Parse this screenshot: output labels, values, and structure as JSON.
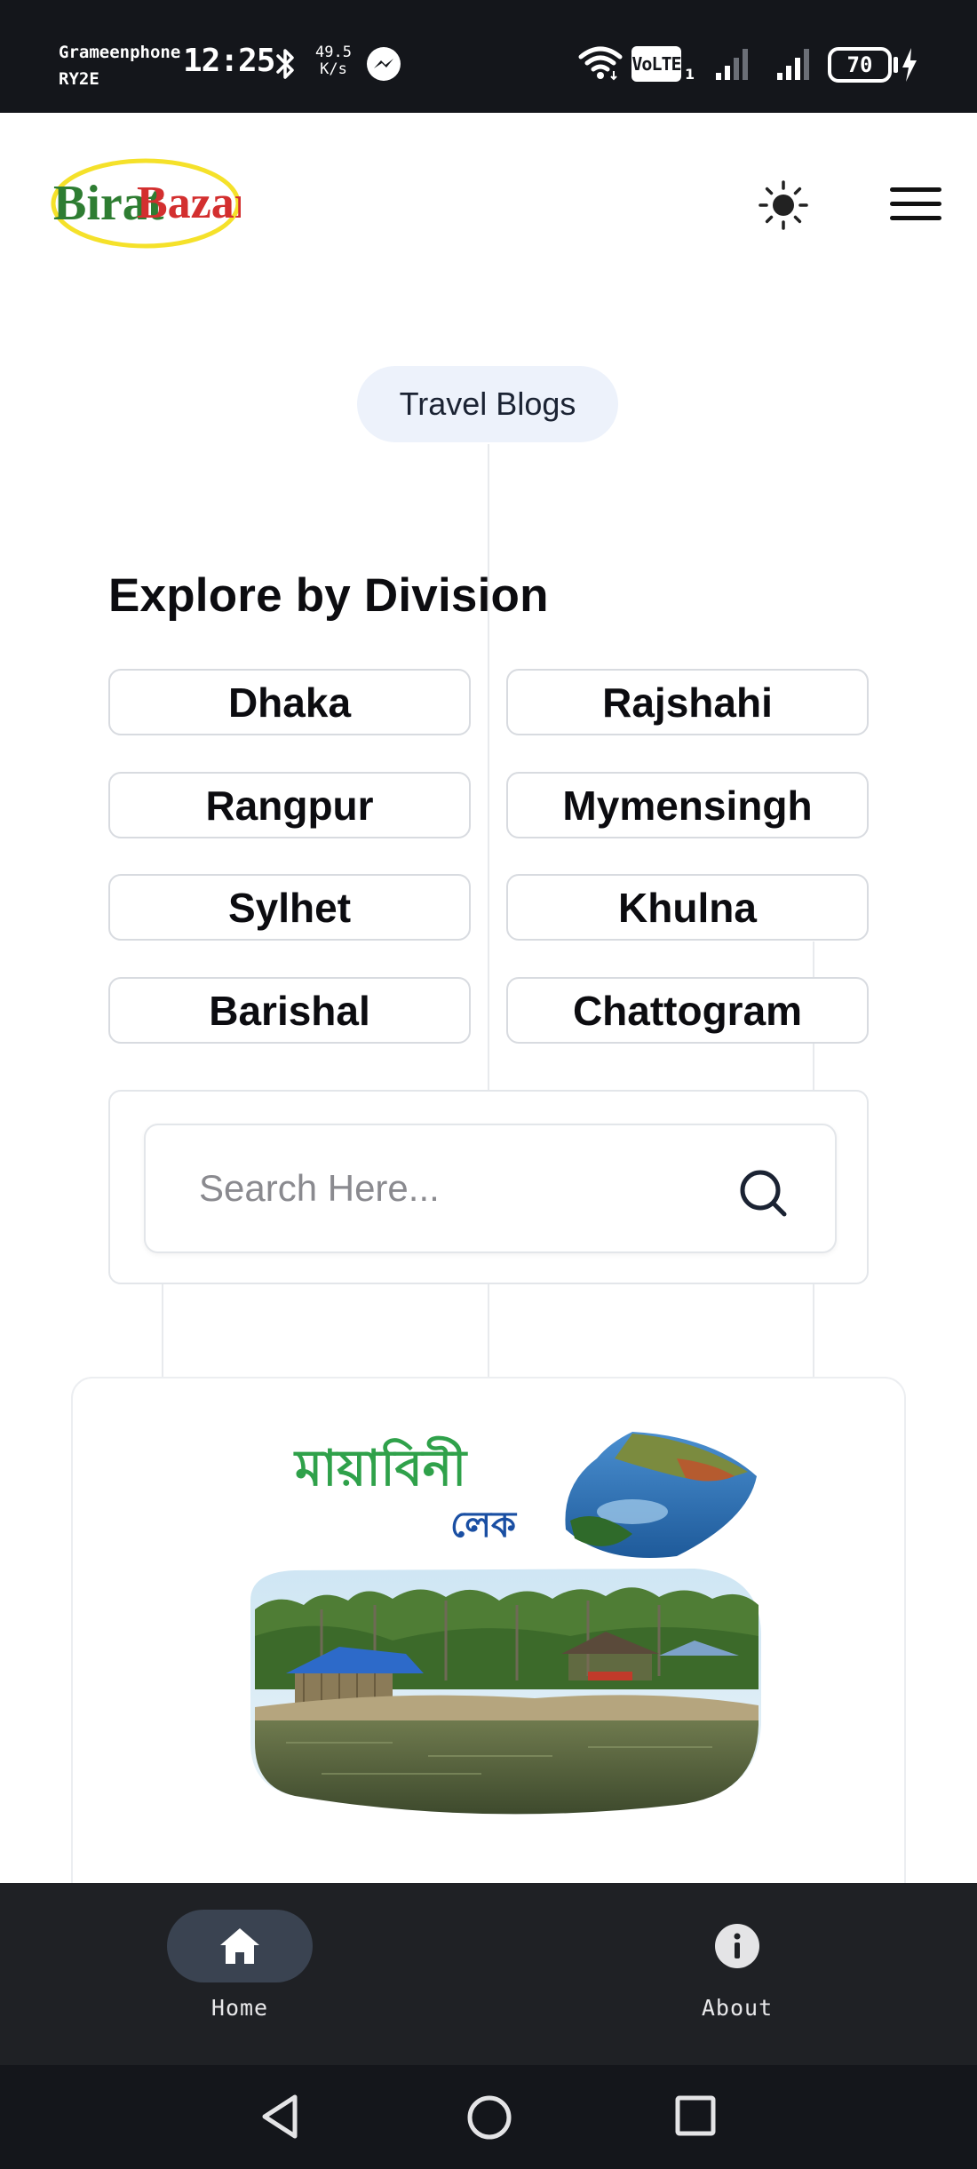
{
  "status_bar": {
    "carrier_line1": "Grameenphone",
    "carrier_line2": "RY2E",
    "time": "12:25",
    "speed_value": "49.5",
    "speed_unit": "K/s",
    "volte": "VoLTE",
    "volte_sub": "1",
    "battery": "70"
  },
  "header": {
    "logo_text_part1": "Birat",
    "logo_text_part2": "Bazar"
  },
  "page": {
    "pill_label": "Travel Blogs",
    "section_title": "Explore by Division"
  },
  "divisions": [
    "Dhaka",
    "Rajshahi",
    "Rangpur",
    "Mymensingh",
    "Sylhet",
    "Khulna",
    "Barishal",
    "Chattogram"
  ],
  "search": {
    "placeholder": "Search Here..."
  },
  "blog_card": {
    "title_line1": "মায়াবিনী",
    "title_line2": "লেক"
  },
  "bottom_nav": {
    "home_label": "Home",
    "about_label": "About"
  },
  "colors": {
    "logo_green": "#2e7d32",
    "logo_red": "#d32f2f",
    "logo_ring": "#f5e12a",
    "pill_bg": "#edf2fb",
    "nav_bg": "#1f2125",
    "nav_active": "#3a4351",
    "blog_title_green": "#2fa14a",
    "blog_title_blue": "#1a4fa3"
  }
}
